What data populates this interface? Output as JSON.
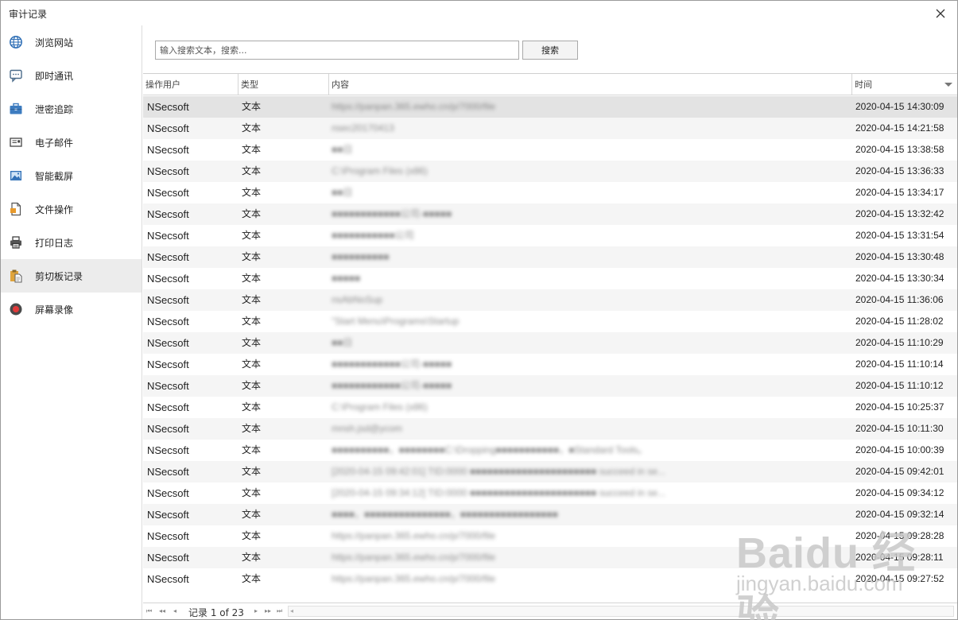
{
  "window": {
    "title": "审计记录"
  },
  "sidebar": {
    "items": [
      {
        "label": "浏览网站",
        "icon": "globe-icon",
        "active": false
      },
      {
        "label": "即时通讯",
        "icon": "chat-icon",
        "active": false
      },
      {
        "label": "泄密追踪",
        "icon": "briefcase-icon",
        "active": false
      },
      {
        "label": "电子邮件",
        "icon": "mail-icon",
        "active": false
      },
      {
        "label": "智能截屏",
        "icon": "picture-icon",
        "active": false
      },
      {
        "label": "文件操作",
        "icon": "file-icon",
        "active": false
      },
      {
        "label": "打印日志",
        "icon": "printer-icon",
        "active": false
      },
      {
        "label": "剪切板记录",
        "icon": "clipboard-icon",
        "active": true
      },
      {
        "label": "屏幕录像",
        "icon": "record-icon",
        "active": false
      }
    ]
  },
  "search": {
    "placeholder": "输入搜索文本，搜索...",
    "value": "",
    "button_label": "搜索"
  },
  "grid": {
    "columns": [
      "操作用户",
      "类型",
      "内容",
      "时间"
    ],
    "rows": [
      {
        "user": "NSecsoft",
        "type": "文本",
        "content": "https://panpan.365.ewho.cn/p/7000/file",
        "time": "2020-04-15 14:30:09"
      },
      {
        "user": "NSecsoft",
        "type": "文本",
        "content": "nsec20170413",
        "time": "2020-04-15 14:21:58"
      },
      {
        "user": "NSecsoft",
        "type": "文本",
        "content": "■■日",
        "time": "2020-04-15 13:38:58"
      },
      {
        "user": "NSecsoft",
        "type": "文本",
        "content": "C:\\Program Files (x86)",
        "time": "2020-04-15 13:36:33"
      },
      {
        "user": "NSecsoft",
        "type": "文本",
        "content": "■■日",
        "time": "2020-04-15 13:34:17"
      },
      {
        "user": "NSecsoft",
        "type": "文本",
        "content": "■■■■■■■■■■■■公司-■■■■■",
        "time": "2020-04-15 13:32:42"
      },
      {
        "user": "NSecsoft",
        "type": "文本",
        "content": "■■■■■■■■■■■公司",
        "time": "2020-04-15 13:31:54"
      },
      {
        "user": "NSecsoft",
        "type": "文本",
        "content": "■■■■■■■■■■",
        "time": "2020-04-15 13:30:48"
      },
      {
        "user": "NSecsoft",
        "type": "文本",
        "content": "■■■■■",
        "time": "2020-04-15 13:30:34"
      },
      {
        "user": "NSecsoft",
        "type": "文本",
        "content": "nsAbNoSup",
        "time": "2020-04-15 11:36:06"
      },
      {
        "user": "NSecsoft",
        "type": "文本",
        "content": "\"Start Menu\\Programs\\Startup",
        "time": "2020-04-15 11:28:02"
      },
      {
        "user": "NSecsoft",
        "type": "文本",
        "content": "■■日",
        "time": "2020-04-15 11:10:29"
      },
      {
        "user": "NSecsoft",
        "type": "文本",
        "content": "■■■■■■■■■■■■公司-■■■■■",
        "time": "2020-04-15 11:10:14"
      },
      {
        "user": "NSecsoft",
        "type": "文本",
        "content": "■■■■■■■■■■■■公司-■■■■■",
        "time": "2020-04-15 11:10:12"
      },
      {
        "user": "NSecsoft",
        "type": "文本",
        "content": "C:\\Program Files (x86)",
        "time": "2020-04-15 10:25:37"
      },
      {
        "user": "NSecsoft",
        "type": "文本",
        "content": "mnsh.jsd@ycom",
        "time": "2020-04-15 10:11:30"
      },
      {
        "user": "NSecsoft",
        "type": "文本",
        "content": "■■■■■■■■■■，■■■■■■■■C:\\Dropping■■■■■■■■■■■，■Standard Tools。",
        "time": "2020-04-15 10:00:39"
      },
      {
        "user": "NSecsoft",
        "type": "文本",
        "content": "[2020-04-15 09:42:01] TID:0000 ■■■■■■■■■■■■■■■■■■■■■■ succeed in se...",
        "time": "2020-04-15 09:42:01"
      },
      {
        "user": "NSecsoft",
        "type": "文本",
        "content": "[2020-04-15 09:34:12] TID:0000 ■■■■■■■■■■■■■■■■■■■■■■ succeed in se...",
        "time": "2020-04-15 09:34:12"
      },
      {
        "user": "NSecsoft",
        "type": "文本",
        "content": "■■■■，■■■■■■■■■■■■■■■，■■■■■■■■■■■■■■■■■",
        "time": "2020-04-15 09:32:14"
      },
      {
        "user": "NSecsoft",
        "type": "文本",
        "content": "https://panpan.365.ewho.cn/p/7000/file",
        "time": "2020-04-15 09:28:28"
      },
      {
        "user": "NSecsoft",
        "type": "文本",
        "content": "https://panpan.365.ewho.cn/p/7000/file",
        "time": "2020-04-15 09:28:11"
      },
      {
        "user": "NSecsoft",
        "type": "文本",
        "content": "https://panpan.365.ewho.cn/p/7000/file",
        "time": "2020-04-15 09:27:52"
      }
    ]
  },
  "pager": {
    "text": "记录 1 of 23"
  },
  "watermark": {
    "brand": "Baidu 经验",
    "url": "jingyan.baidu.com"
  }
}
